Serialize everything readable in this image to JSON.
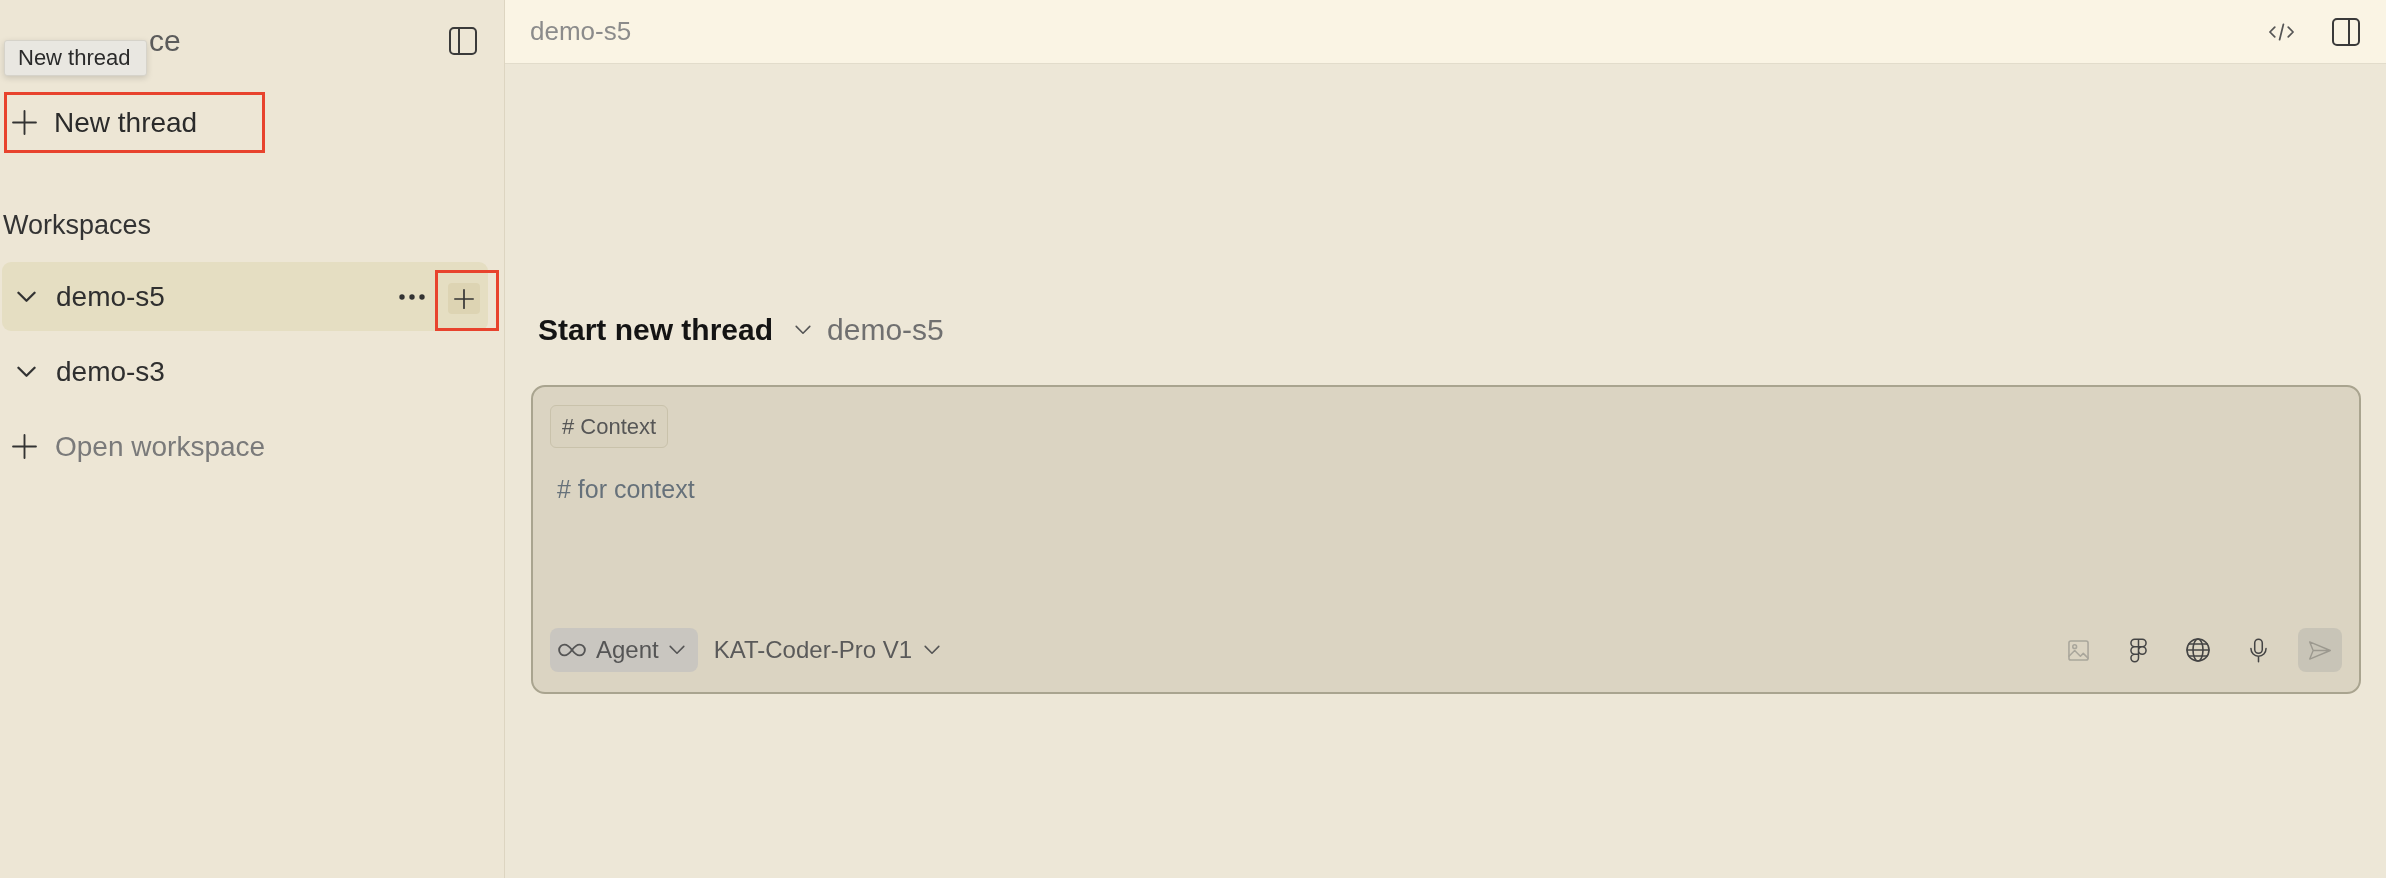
{
  "tooltip": {
    "text": "New thread"
  },
  "sidebar": {
    "title": "ce",
    "new_thread": {
      "label": "New thread",
      "highlighted": true
    },
    "section_label": "Workspaces",
    "workspaces": [
      {
        "name": "demo-s5",
        "selected": true,
        "expanded": true,
        "hovered": true,
        "add_highlighted": true
      },
      {
        "name": "demo-s3",
        "selected": false,
        "expanded": true,
        "hovered": false,
        "add_highlighted": false
      }
    ],
    "open_workspace": {
      "label": "Open workspace"
    }
  },
  "header": {
    "title": "demo-s5"
  },
  "composer": {
    "heading": "Start new thread",
    "workspace": "demo-s5",
    "context_chip": "# Context",
    "placeholder": "# for context",
    "mode": {
      "label": "Agent"
    },
    "model": {
      "label": "KAT-Coder-Pro V1"
    },
    "tools": [
      {
        "kind": "image",
        "disabled": true
      },
      {
        "kind": "design",
        "disabled": false
      },
      {
        "kind": "globe",
        "disabled": false
      },
      {
        "kind": "mic",
        "disabled": false
      }
    ],
    "send": {
      "disabled": true
    }
  }
}
